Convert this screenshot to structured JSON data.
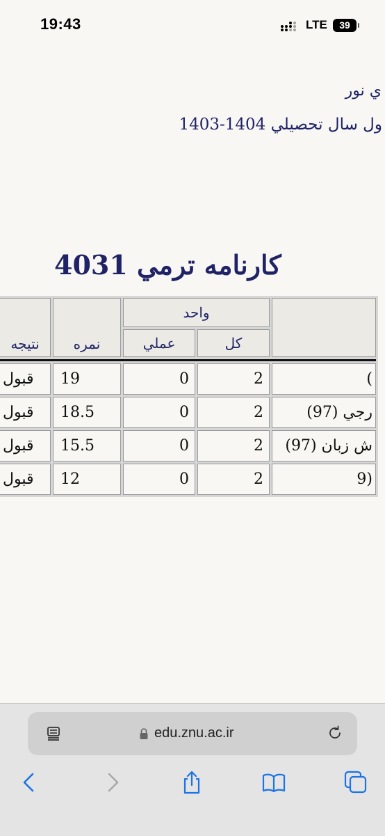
{
  "status": {
    "time": "19:43",
    "network": "LTE",
    "battery": "39"
  },
  "page": {
    "line1": "ي نور",
    "line2": "ول سال تحصيلي 1404-1403",
    "title": "كارنامه ترمي 4031"
  },
  "table": {
    "headers": {
      "result": "نتيجه",
      "grade": "نمره",
      "units": "واحد",
      "practical": "عملي",
      "total": "كل"
    },
    "rows": [
      {
        "result": "قبول",
        "grade": "19",
        "practical": "0",
        "total": "2",
        "course": ")"
      },
      {
        "result": "قبول",
        "grade": "18.5",
        "practical": "0",
        "total": "2",
        "course": "رجي (97)"
      },
      {
        "result": "قبول",
        "grade": "15.5",
        "practical": "0",
        "total": "2",
        "course": "ش زبان (97)"
      },
      {
        "result": "قبول",
        "grade": "12",
        "practical": "0",
        "total": "2",
        "course": "(9"
      }
    ]
  },
  "browser": {
    "url": "edu.znu.ac.ir"
  },
  "colors": {
    "heading": "#1f2366",
    "page_bg": "#f9f7f3",
    "toolbar_icons": "#1a73e8"
  }
}
